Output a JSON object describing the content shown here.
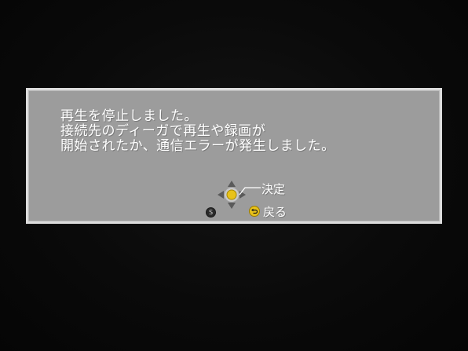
{
  "dialog": {
    "message_lines": [
      "再生を停止しました。",
      "接続先のディーガで再生や録画が",
      "開始されたか、通信エラーが発生しました。"
    ]
  },
  "guide": {
    "confirm_label": "決定",
    "back_label": "戻る",
    "s_button_glyph": "S"
  },
  "icons": {
    "dpad": "dpad-icon",
    "confirm_center": "yellow-center-button",
    "back": "return-icon"
  },
  "colors": {
    "dialog_bg": "#9c9c9c",
    "dialog_border": "#dcdcdc",
    "text": "#ffffff",
    "accent_yellow": "#e8c21a"
  }
}
